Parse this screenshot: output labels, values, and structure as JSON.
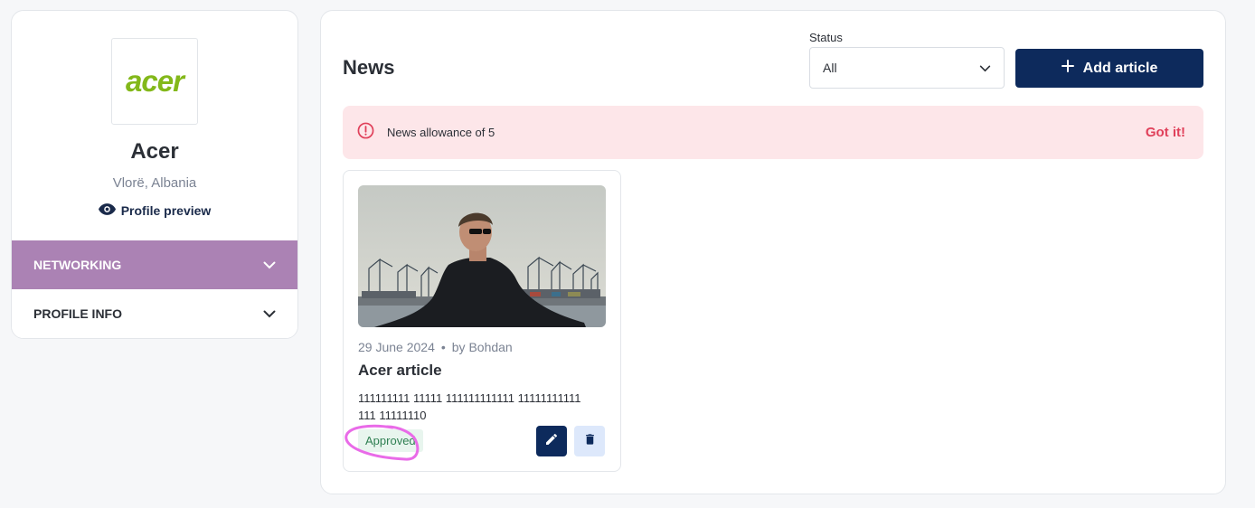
{
  "profile": {
    "logo_text": "acer",
    "name": "Acer",
    "location": "Vlorë, Albania",
    "preview_label": "Profile preview",
    "icons": {
      "preview": "eye-icon",
      "expand": "chevron-down-icon"
    }
  },
  "sidebar": {
    "items": [
      {
        "label": "NETWORKING",
        "active": true
      },
      {
        "label": "PROFILE INFO",
        "active": false
      }
    ],
    "active_color": "#ab82b4"
  },
  "main": {
    "title": "News",
    "status_filter": {
      "label": "Status",
      "selected": "All"
    },
    "add_button_label": "Add article",
    "alert": {
      "text": "News allowance of 5",
      "action": "Got it!",
      "icon": "alert-circle-icon"
    }
  },
  "articles": [
    {
      "date": "29 June 2024",
      "separator": "•",
      "author": "by Bohdan",
      "title": "Acer article",
      "excerpt": "111111111 11111 111111111111 11111111111 111 11111110",
      "status": "Approved",
      "image": "photo-man-sunglasses-port-cranes",
      "actions": {
        "edit": "pencil-icon",
        "delete": "trash-icon"
      }
    }
  ],
  "colors": {
    "primary": "#0d2a5c",
    "alert_bg": "#fde6e9",
    "alert_accent": "#e0405a",
    "approved_bg": "#e8f5ee",
    "approved_text": "#2f7f52",
    "brand_logo": "#83b81a",
    "annotation": "#e96be8"
  }
}
